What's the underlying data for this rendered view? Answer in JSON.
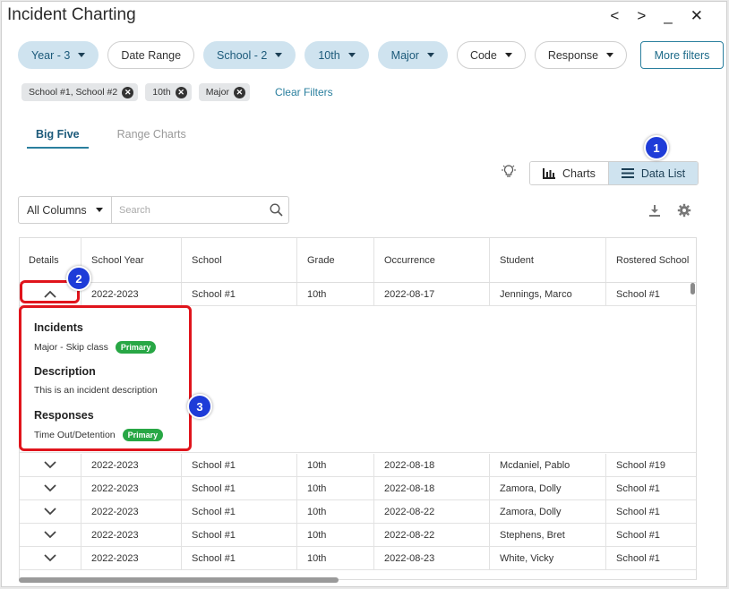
{
  "window": {
    "title": "Incident Charting",
    "controls": [
      "<",
      ">",
      "_",
      "✕"
    ]
  },
  "filters": [
    {
      "label": "Year - 3",
      "selected": true
    },
    {
      "label": "Date Range",
      "selected": false
    },
    {
      "label": "School - 2",
      "selected": true
    },
    {
      "label": "10th",
      "selected": true
    },
    {
      "label": "Major",
      "selected": true
    },
    {
      "label": "Code",
      "selected": false
    },
    {
      "label": "Response",
      "selected": false
    }
  ],
  "more_filters_label": "More filters",
  "active_chips": [
    "School #1, School #2",
    "10th",
    "Major"
  ],
  "clear_filters_label": "Clear Filters",
  "tabs": [
    {
      "label": "Big Five",
      "active": true
    },
    {
      "label": "Range Charts",
      "active": false
    }
  ],
  "view_toggle": {
    "charts_label": "Charts",
    "data_list_label": "Data List",
    "active": "Data List"
  },
  "search": {
    "column_select": "All Columns",
    "placeholder": "Search"
  },
  "table": {
    "columns": [
      "Details",
      "School Year",
      "School",
      "Grade",
      "Occurrence",
      "Student",
      "Rostered School"
    ],
    "rows": [
      [
        "2022-2023",
        "School #1",
        "10th",
        "2022-08-17",
        "Jennings, Marco",
        "School #1"
      ],
      [
        "2022-2023",
        "School #1",
        "10th",
        "2022-08-18",
        "Mcdaniel, Pablo",
        "School #19"
      ],
      [
        "2022-2023",
        "School #1",
        "10th",
        "2022-08-18",
        "Zamora, Dolly",
        "School #1"
      ],
      [
        "2022-2023",
        "School #1",
        "10th",
        "2022-08-22",
        "Zamora, Dolly",
        "School #1"
      ],
      [
        "2022-2023",
        "School #1",
        "10th",
        "2022-08-22",
        "Stephens, Bret",
        "School #1"
      ],
      [
        "2022-2023",
        "School #1",
        "10th",
        "2022-08-23",
        "White, Vicky",
        "School #1"
      ]
    ],
    "expanded_details": {
      "incidents_heading": "Incidents",
      "incidents_text": "Major - Skip class",
      "incidents_badge": "Primary",
      "description_heading": "Description",
      "description_text": "This is an incident description",
      "responses_heading": "Responses",
      "responses_text": "Time Out/Detention",
      "responses_badge": "Primary"
    }
  },
  "callouts": [
    "1",
    "2",
    "3"
  ],
  "colors": {
    "accent": "#2a7f9e",
    "selected_pill": "#cfe3ef",
    "badge_green": "#28a745",
    "callout_blue": "#1e3cd8",
    "highlight_red": "#e0141c"
  }
}
